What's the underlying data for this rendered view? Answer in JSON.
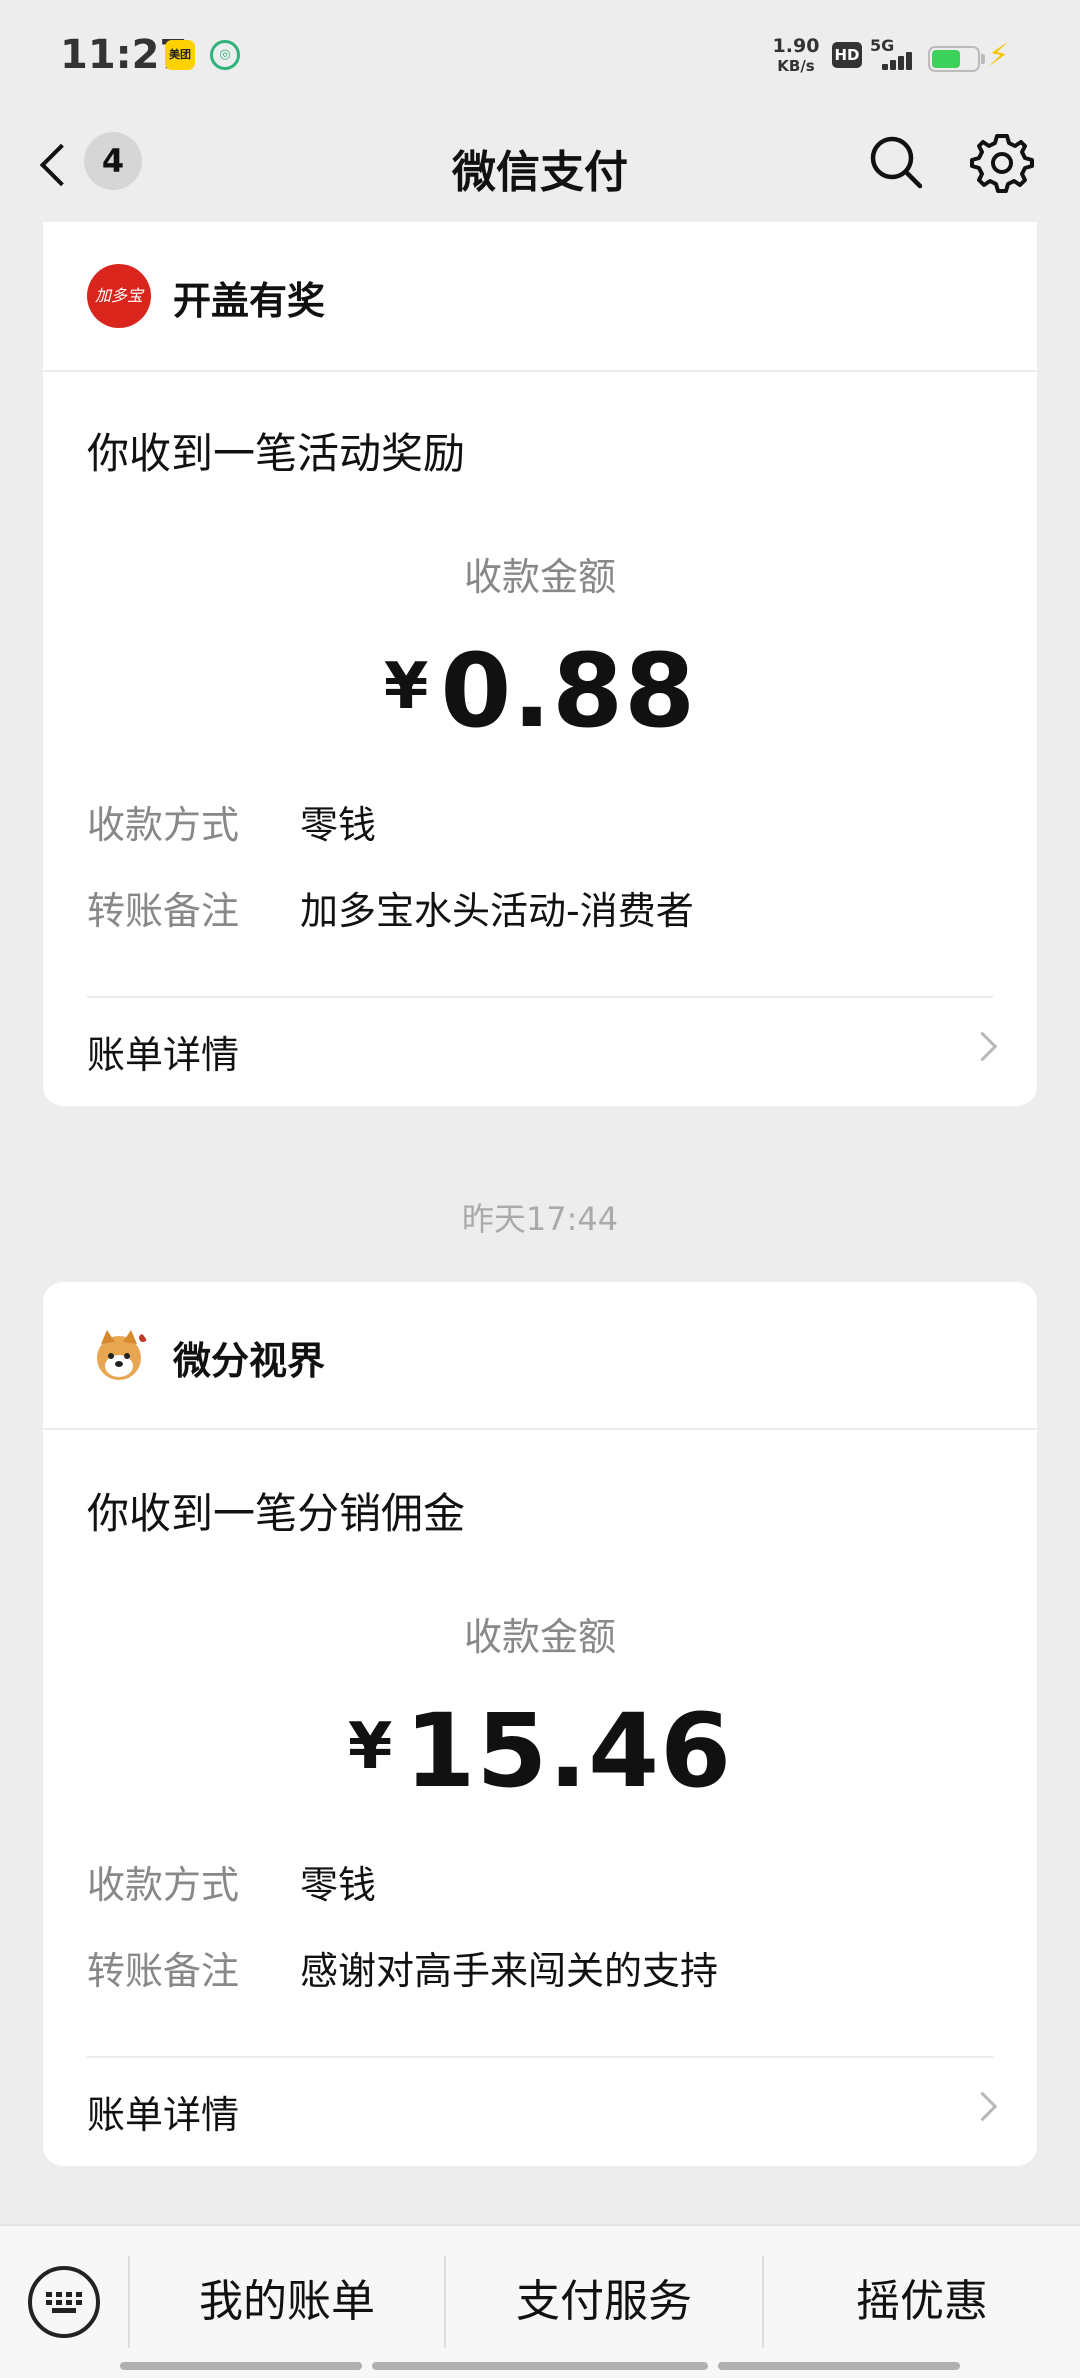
{
  "status_bar": {
    "time": "11:27",
    "app_icon_meituan": "美团",
    "net_speed_value": "1.90",
    "net_speed_unit": "KB/s",
    "hd_label": "HD",
    "network": "5G"
  },
  "nav": {
    "title": "微信支付",
    "unread_count": "4"
  },
  "messages": [
    {
      "merchant_name": "开盖有奖",
      "logo_text": "加多宝",
      "title": "你收到一笔活动奖励",
      "amount_label": "收款金额",
      "currency": "¥",
      "amount": "0.88",
      "method_key": "收款方式",
      "method_value": "零钱",
      "note_key": "转账备注",
      "note_value": "加多宝水头活动-消费者",
      "bill_label": "账单详情"
    },
    {
      "merchant_name": "微分视界",
      "title": "你收到一笔分销佣金",
      "amount_label": "收款金额",
      "currency": "¥",
      "amount": "15.46",
      "method_key": "收款方式",
      "method_value": "零钱",
      "note_key": "转账备注",
      "note_value": "感谢对高手来闯关的支持",
      "bill_label": "账单详情"
    }
  ],
  "timestamp": "昨天17:44",
  "bottom_menu": {
    "items": [
      "我的账单",
      "支付服务",
      "摇优惠"
    ]
  },
  "colors": {
    "background": "#ededed",
    "card": "#ffffff",
    "muted_text": "#888888",
    "battery_green": "#3bd15a"
  }
}
